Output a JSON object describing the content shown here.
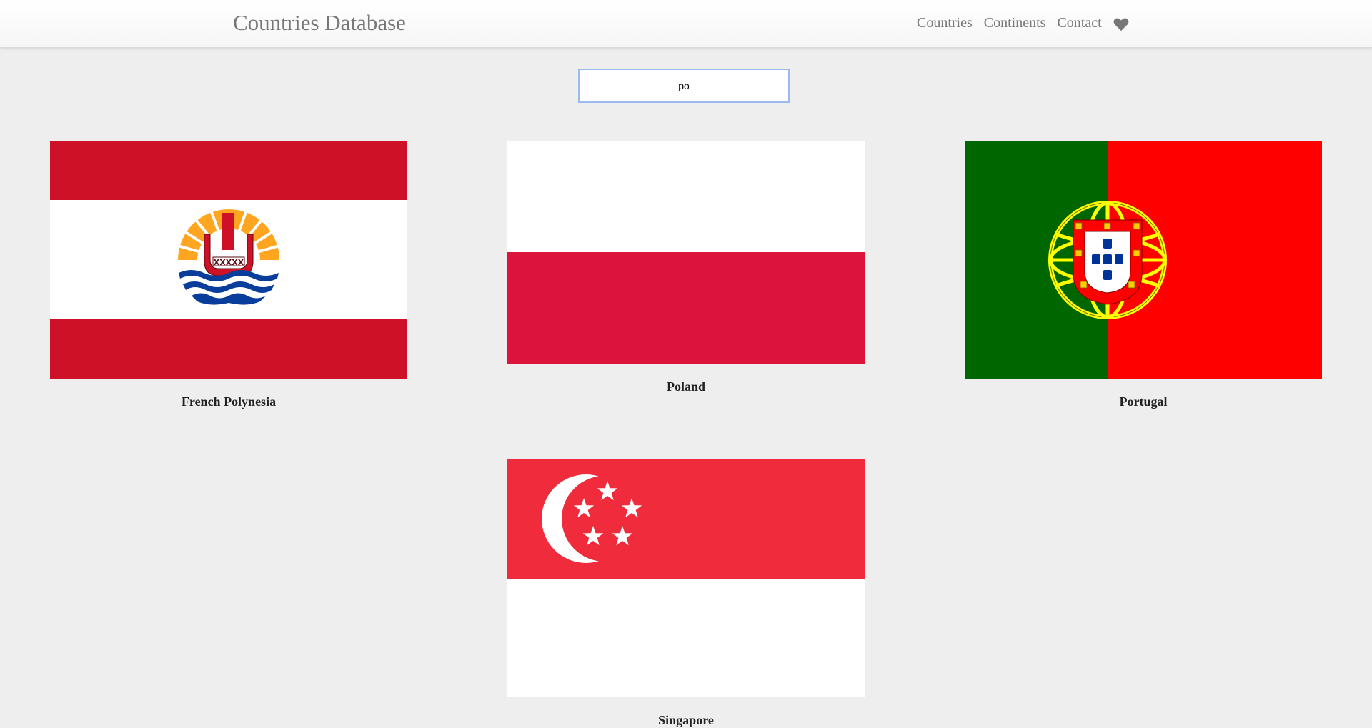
{
  "navbar": {
    "brand": "Countries Database",
    "links": [
      {
        "label": "Countries"
      },
      {
        "label": "Continents"
      },
      {
        "label": "Contact"
      }
    ],
    "favorites_icon": "heart-icon"
  },
  "search": {
    "value": "po",
    "placeholder": ""
  },
  "results": [
    {
      "name": "French Polynesia",
      "flag": "french-polynesia-flag"
    },
    {
      "name": "Poland",
      "flag": "poland-flag"
    },
    {
      "name": "Portugal",
      "flag": "portugal-flag"
    },
    {
      "name": "Singapore",
      "flag": "singapore-flag"
    }
  ],
  "colors": {
    "background": "#eeeeee",
    "nav_text": "#777777",
    "search_border": "#9bbbf0"
  }
}
